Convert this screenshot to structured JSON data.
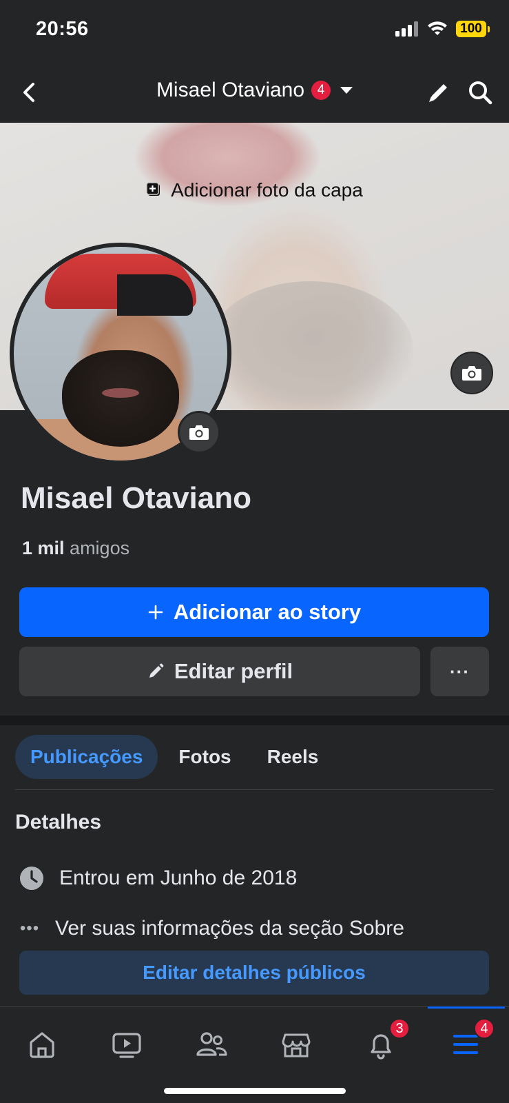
{
  "status": {
    "time": "20:56",
    "battery": "100"
  },
  "nav": {
    "title": "Misael Otaviano",
    "badge": "4"
  },
  "cover": {
    "add_cover_label": "Adicionar foto da capa"
  },
  "profile": {
    "name": "Misael Otaviano",
    "friends_count": "1 mil",
    "friends_label": "amigos"
  },
  "actions": {
    "add_story": "Adicionar ao story",
    "edit_profile": "Editar perfil",
    "more": "···"
  },
  "tabs": [
    {
      "label": "Publicações",
      "active": true
    },
    {
      "label": "Fotos",
      "active": false
    },
    {
      "label": "Reels",
      "active": false
    }
  ],
  "details": {
    "title": "Detalhes",
    "joined": "Entrou em Junho de 2018",
    "about": "Ver suas informações da seção Sobre",
    "edit_public": "Editar detalhes públicos"
  },
  "tabbar": {
    "items": [
      {
        "icon": "home-icon"
      },
      {
        "icon": "video-icon"
      },
      {
        "icon": "friends-icon"
      },
      {
        "icon": "marketplace-icon"
      },
      {
        "icon": "bell-icon",
        "badge": "3"
      },
      {
        "icon": "menu-icon",
        "badge": "4",
        "active": true
      }
    ]
  },
  "colors": {
    "accent": "#0866ff",
    "badge": "#e41e3f",
    "background": "#242526"
  }
}
